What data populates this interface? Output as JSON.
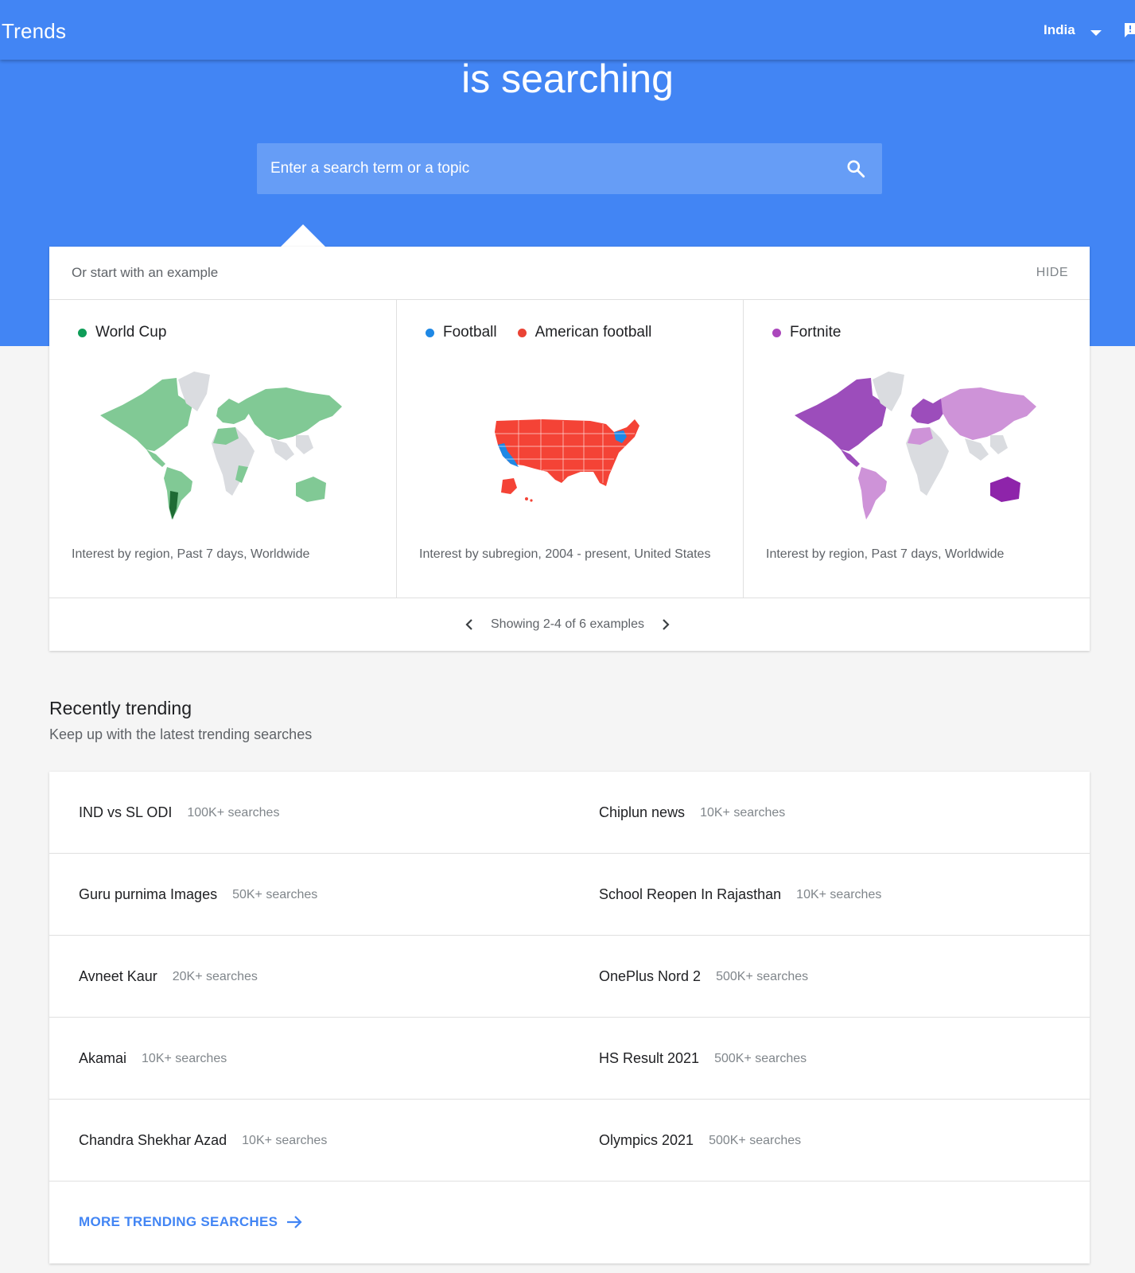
{
  "header": {
    "brand": "Trends",
    "country": "India"
  },
  "hero": {
    "title": "is searching"
  },
  "search": {
    "placeholder": "Enter a search term or a topic"
  },
  "examples": {
    "header": "Or start with an example",
    "hide_label": "HIDE",
    "pager_text": "Showing 2-4 of 6 examples",
    "cards": [
      {
        "terms": [
          {
            "label": "World Cup",
            "color": "#0f9d58"
          }
        ],
        "caption": "Interest by region, Past 7 days, Worldwide"
      },
      {
        "terms": [
          {
            "label": "Football",
            "color": "#1e88e5"
          },
          {
            "label": "American football",
            "color": "#ea4335"
          }
        ],
        "caption": "Interest by subregion, 2004 - present, United States"
      },
      {
        "terms": [
          {
            "label": "Fortnite",
            "color": "#ab47bc"
          }
        ],
        "caption": "Interest by region, Past 7 days, Worldwide"
      }
    ]
  },
  "trending": {
    "title": "Recently trending",
    "subtitle": "Keep up with the latest trending searches",
    "rows": [
      [
        {
          "name": "IND vs SL ODI",
          "count": "100K+ searches"
        },
        {
          "name": "Chiplun news",
          "count": "10K+ searches"
        }
      ],
      [
        {
          "name": "Guru purnima Images",
          "count": "50K+ searches"
        },
        {
          "name": "School Reopen In Rajasthan",
          "count": "10K+ searches"
        }
      ],
      [
        {
          "name": "Avneet Kaur",
          "count": "20K+ searches"
        },
        {
          "name": "OnePlus Nord 2",
          "count": "500K+ searches"
        }
      ],
      [
        {
          "name": "Akamai",
          "count": "10K+ searches"
        },
        {
          "name": "HS Result 2021",
          "count": "500K+ searches"
        }
      ],
      [
        {
          "name": "Chandra Shekhar Azad",
          "count": "10K+ searches"
        },
        {
          "name": "Olympics 2021",
          "count": "500K+ searches"
        }
      ]
    ],
    "more_label": "MORE TRENDING SEARCHES"
  }
}
